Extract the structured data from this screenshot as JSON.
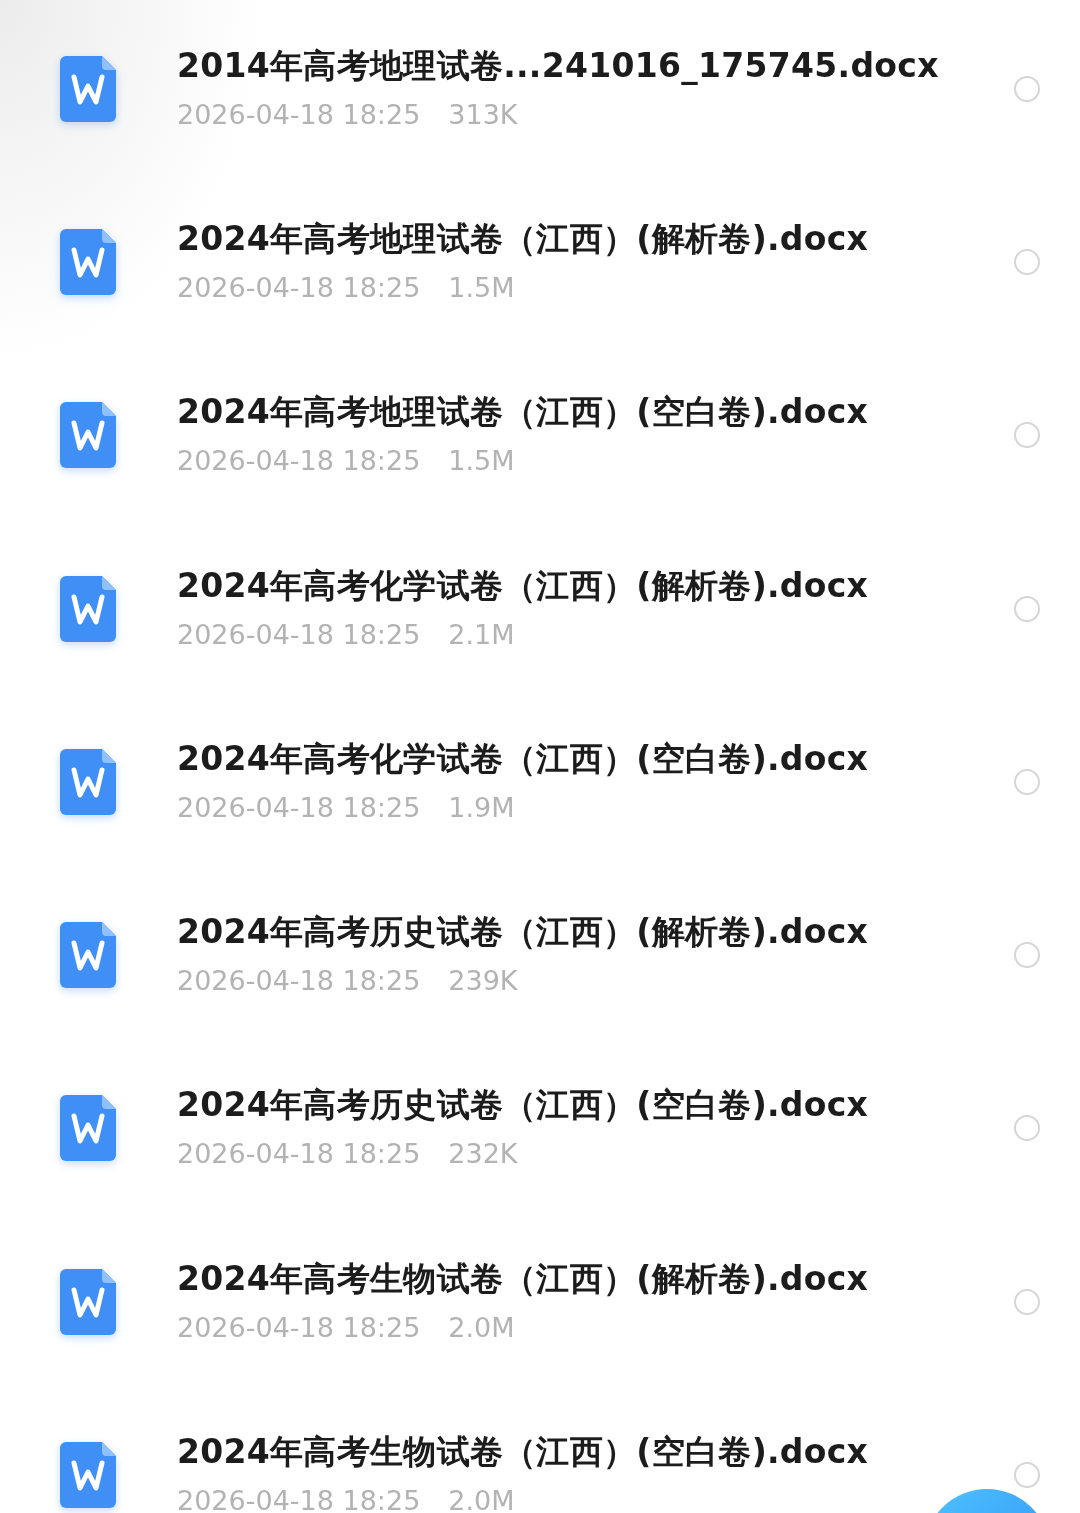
{
  "files": [
    {
      "name": "2014年高考地理试卷...241016_175745.docx",
      "date": "2026-04-18 18:25",
      "size": "313K",
      "selected": false
    },
    {
      "name": "2024年高考地理试卷（江西）(解析卷).docx",
      "date": "2026-04-18 18:25",
      "size": "1.5M",
      "selected": false
    },
    {
      "name": "2024年高考地理试卷（江西）(空白卷).docx",
      "date": "2026-04-18 18:25",
      "size": "1.5M",
      "selected": false
    },
    {
      "name": "2024年高考化学试卷（江西）(解析卷).docx",
      "date": "2026-04-18 18:25",
      "size": "2.1M",
      "selected": false
    },
    {
      "name": "2024年高考化学试卷（江西）(空白卷).docx",
      "date": "2026-04-18 18:25",
      "size": "1.9M",
      "selected": false
    },
    {
      "name": "2024年高考历史试卷（江西）(解析卷).docx",
      "date": "2026-04-18 18:25",
      "size": "239K",
      "selected": false
    },
    {
      "name": "2024年高考历史试卷（江西）(空白卷).docx",
      "date": "2026-04-18 18:25",
      "size": "232K",
      "selected": false
    },
    {
      "name": "2024年高考生物试卷（江西）(解析卷).docx",
      "date": "2026-04-18 18:25",
      "size": "2.0M",
      "selected": false
    },
    {
      "name": "2024年高考生物试卷（江西）(空白卷).docx",
      "date": "2026-04-18 18:25",
      "size": "2.0M",
      "selected": false
    }
  ]
}
